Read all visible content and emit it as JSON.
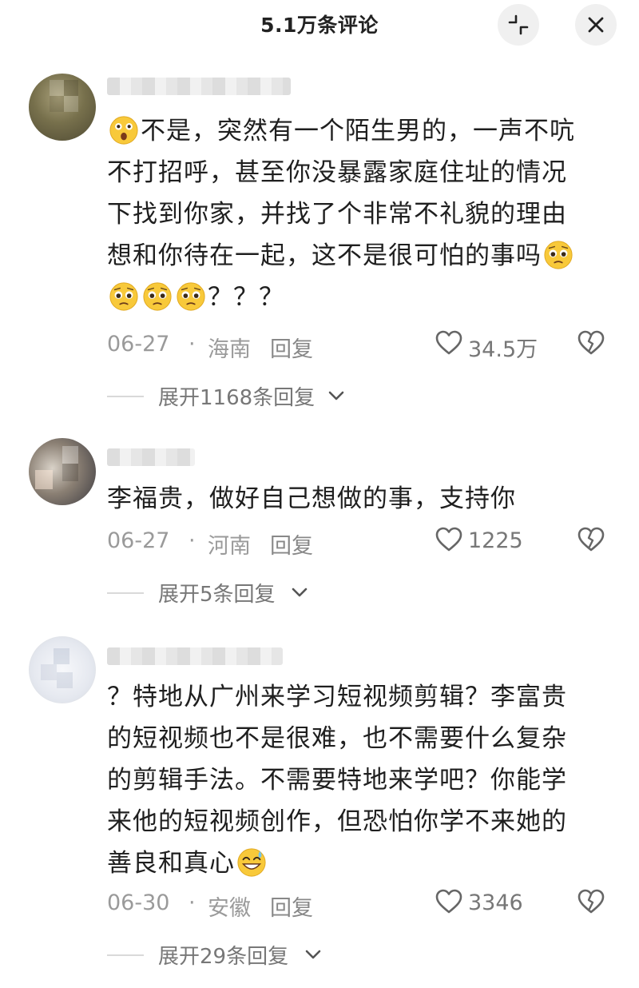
{
  "header": {
    "title": "5.1万条评论",
    "collapse_icon": "collapse-icon",
    "close_icon": "close-icon"
  },
  "comments": [
    {
      "text_lines": [
        "不是，突然有一个陌生男的，一声不吭",
        "不打招呼，甚至你没暴露家庭住址的情况",
        "下找到你家，并找了个非常不礼貌的理由",
        "想和你待在一起，这不是很可怕的事吗",
        "？？？"
      ],
      "date": "06-27",
      "dot": "·",
      "location": "海南",
      "reply": "回复",
      "likes": "34.5万",
      "expand": "展开1168条回复"
    },
    {
      "text_lines": [
        "李福贵，做好自己想做的事，支持你"
      ],
      "date": "06-27",
      "dot": "·",
      "location": "河南",
      "reply": "回复",
      "likes": "1225",
      "expand": "展开5条回复"
    },
    {
      "text_lines": [
        "？特地从广州来学习短视频剪辑？李富贵",
        "的短视频也不是很难，也不需要什么复杂",
        "的剪辑手法。不需要特地来学吧？你能学",
        "来他的短视频创作，但恐怕你学不来她的",
        "善良和真心"
      ],
      "date": "06-30",
      "dot": "·",
      "location": "安徽",
      "reply": "回复",
      "likes": "3346",
      "expand": "展开29条回复"
    }
  ],
  "colors": {
    "text": "#1f1f1f",
    "meta": "#9a9a9a",
    "emoji_yellow": "#f8c93a"
  }
}
